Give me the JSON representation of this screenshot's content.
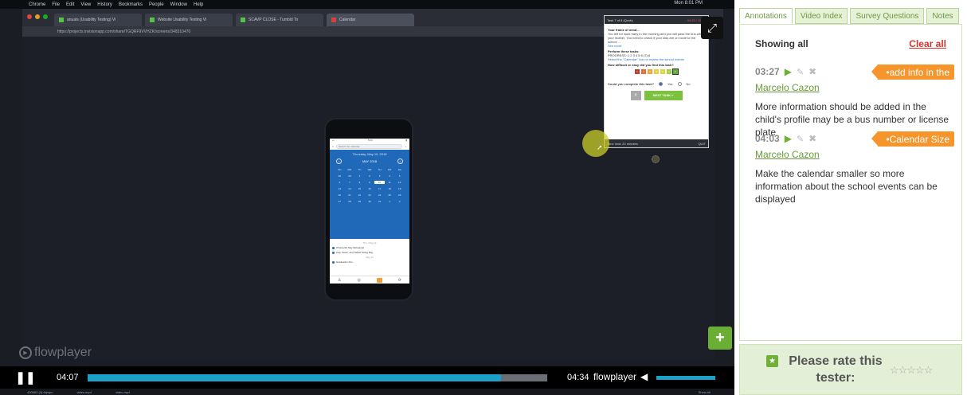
{
  "video": {
    "mac_menu": [
      "Chrome",
      "File",
      "Edit",
      "View",
      "History",
      "Bookmarks",
      "People",
      "Window",
      "Help"
    ],
    "mac_right": "Mon 8:01 PM",
    "browser_tabs": [
      {
        "label": "anuals (Usability Testing) Vi",
        "icon": "green"
      },
      {
        "label": "Website Usability Testing Vi",
        "icon": "green"
      },
      {
        "label": "SCAVP CLOSE - Tumbld To",
        "icon": "green"
      },
      {
        "label": "Calendar",
        "icon": "red"
      }
    ],
    "url": "https://projects.invisionapp.com/share/TGQRF9VVHZK/screens/348310470",
    "phone": {
      "search_placeholder": "Search the calendar",
      "date_line": "Thursday, May 10, 2018",
      "month": "MAY 2018",
      "weekdays": [
        "SU",
        "MO",
        "TU",
        "WE",
        "TH",
        "FR",
        "SA"
      ],
      "days": [
        "29",
        "30",
        "1",
        "2",
        "3",
        "4",
        "5",
        "6",
        "7",
        "8",
        "9",
        "10",
        "11",
        "12",
        "13",
        "14",
        "15",
        "16",
        "17",
        "18",
        "19",
        "20",
        "21",
        "22",
        "23",
        "24",
        "25",
        "26",
        "27",
        "28",
        "29",
        "30",
        "31",
        "1",
        "2"
      ],
      "today": "10",
      "events": [
        {
          "type": "sep",
          "text": "Thu, May 10"
        },
        {
          "type": "ev",
          "text": "Chorus/Art Day Rehearsal"
        },
        {
          "type": "ev",
          "text": "Cap, Gown, and Tassel Sizing Day"
        },
        {
          "type": "sep",
          "text": "May 11"
        },
        {
          "type": "ev",
          "text": "Graduation Fire"
        }
      ]
    },
    "task": {
      "header": "Task 7 of 8 (Qcnb)",
      "rec": "04:23 / 10:00",
      "frame_title": "Your frame of mind...",
      "frame_text": "You left for work early in the morning and you will pass the bus with your mother. You need to check if your kids are on route to the school ...",
      "see_more": "See more",
      "perform_title": "Perform these tasks:",
      "progress": "PROGRESS: 1 2 3 4 5 6 (7) 8",
      "instruction": "Select the \"Calendar\" icon to review the school events",
      "difficulty_q": "How difficult or easy did you find this task?",
      "scale": [
        "1",
        "2",
        "3",
        "4",
        "5",
        "6",
        "7"
      ],
      "scale_low": "Very difficult",
      "scale_high": "Very easy",
      "complete_q": "Could you complete this task?",
      "yes": "Yes",
      "no": "No",
      "next": "NEXT TASK »",
      "footer_left": "Time limit: 20 minutes",
      "footer_right": "QUIT"
    },
    "flowplayer_logo": "flowplayer",
    "controls": {
      "current": "04:07",
      "total": "04:34",
      "brand": "flowplayer",
      "progress_fraction": 0.9
    },
    "dock": [
      "430683 (3).thjmpu",
      "video.mp4",
      "video.mp4",
      "Show All"
    ]
  },
  "panel": {
    "tabs": [
      "Annotations",
      "Video Index",
      "Survey Questions",
      "Notes"
    ],
    "showing": "Showing all",
    "clear_all": "Clear all",
    "annotations": [
      {
        "time": "03:27",
        "tag": "add info in the",
        "author": "Marcelo Cazon",
        "text": "More information should be added in the child's profile may be a bus number or license plate"
      },
      {
        "time": "04:03",
        "tag": "Calendar Size",
        "author": "Marcelo Cazon",
        "text": "Make the calendar smaller so more information about the school events can be displayed"
      }
    ],
    "rate_text": "Please rate this tester:",
    "stars": "☆☆☆☆☆"
  },
  "colors": {
    "accent_green": "#6fb134",
    "tag_orange": "#f5952c",
    "clear_red": "#d9342b",
    "progress_blue": "#1ba1c8"
  }
}
